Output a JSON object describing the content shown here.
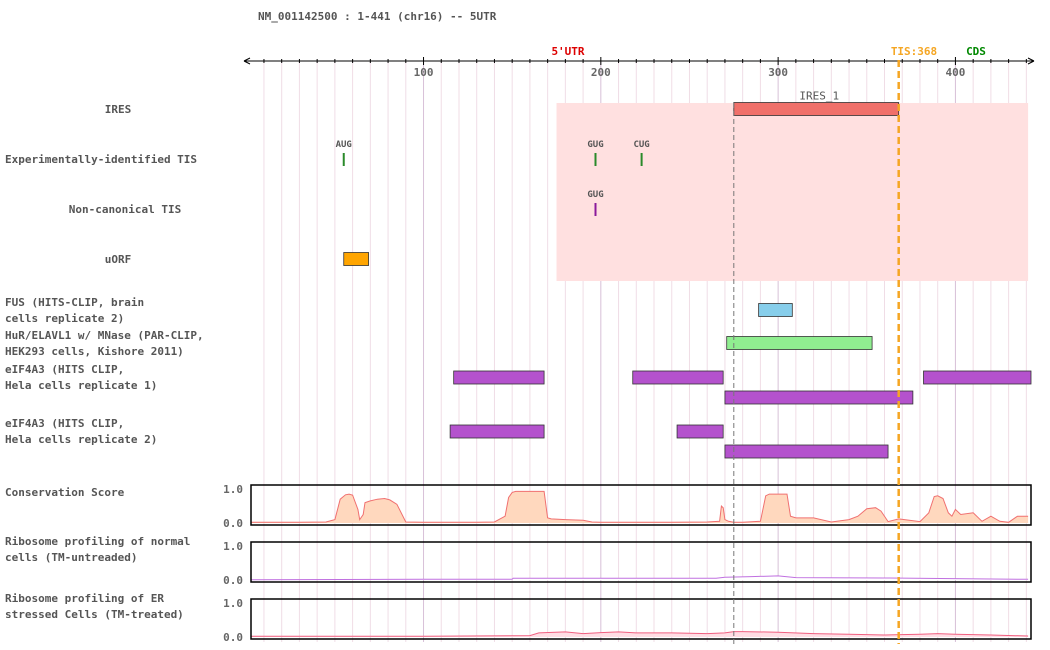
{
  "header": "NM_001142500 : 1-441 (chr16) -- 5UTR",
  "colors": {
    "utr_label": "#dd0000",
    "tis_line": "#f5a623",
    "cds_label": "#008800",
    "ires_bg": "#ffe0e0",
    "ires_bar": "#f0706a",
    "exp_tis": "#2a8a2a",
    "noncanonical": "#8b1a9b",
    "uorf": "#ffa500",
    "fus": "#87ceeb",
    "hur": "#90ee90",
    "eif4a3": "#b452cd",
    "conservation_fill": "#ffd8be",
    "conservation_line": "#f07070",
    "ribo_normal": "#c070e0",
    "ribo_stress": "#f06080"
  },
  "axis": {
    "min": 1,
    "max": 441,
    "ticks": [
      "100",
      "200",
      "300",
      "400"
    ],
    "utr_label": "5'UTR",
    "tis_label": "TIS:368",
    "cds_label": "CDS"
  },
  "chart_data": {
    "type": "genome_track",
    "transcript": "NM_001142500",
    "range": [
      1,
      441
    ],
    "tis_position": 368,
    "ires_highlight": [
      175,
      441
    ],
    "guide_line": 275,
    "tracks": [
      {
        "label_lines": [
          "IRES"
        ],
        "type": "features",
        "features": [
          {
            "start": 275,
            "end": 368,
            "name": "IRES_1",
            "color": "#f0706a"
          }
        ]
      },
      {
        "label_lines": [
          "Experimentally-identified TIS"
        ],
        "type": "sites",
        "sites": [
          {
            "pos": 55,
            "codon": "AUG",
            "color": "#2a8a2a"
          },
          {
            "pos": 197,
            "codon": "GUG",
            "color": "#2a8a2a"
          },
          {
            "pos": 223,
            "codon": "CUG",
            "color": "#2a8a2a"
          }
        ]
      },
      {
        "label_lines": [
          "Non-canonical TIS"
        ],
        "type": "sites",
        "sites": [
          {
            "pos": 197,
            "codon": "GUG",
            "color": "#8b1a9b"
          }
        ]
      },
      {
        "label_lines": [
          "uORF"
        ],
        "type": "features",
        "features": [
          {
            "start": 55,
            "end": 69,
            "color": "#ffa500"
          }
        ]
      },
      {
        "label_lines": [
          "FUS (HITS-CLIP, brain",
          "cells replicate 2)"
        ],
        "type": "features",
        "features": [
          {
            "start": 289,
            "end": 308,
            "color": "#87ceeb"
          }
        ]
      },
      {
        "label_lines": [
          "HuR/ELAVL1 w/ MNase (PAR-CLIP,",
          "HEK293 cells, Kishore 2011)"
        ],
        "type": "features",
        "features": [
          {
            "start": 271,
            "end": 353,
            "color": "#90ee90"
          }
        ]
      },
      {
        "label_lines": [
          "eIF4A3 (HITS CLIP,",
          "Hela cells replicate 1)"
        ],
        "type": "features",
        "features": [
          {
            "start": 117,
            "end": 168,
            "color": "#b452cd"
          },
          {
            "start": 218,
            "end": 269,
            "color": "#b452cd"
          },
          {
            "start": 382,
            "end": 443,
            "color": "#b452cd"
          },
          {
            "start": 270,
            "end": 376,
            "color": "#b452cd",
            "row": 1
          }
        ]
      },
      {
        "label_lines": [
          "eIF4A3 (HITS CLIP,",
          "Hela cells replicate 2)"
        ],
        "type": "features",
        "features": [
          {
            "start": 115,
            "end": 168,
            "color": "#b452cd"
          },
          {
            "start": 243,
            "end": 269,
            "color": "#b452cd"
          },
          {
            "start": 270,
            "end": 362,
            "color": "#b452cd",
            "row": 1
          }
        ]
      },
      {
        "label_lines": [
          "Conservation Score"
        ],
        "type": "signal",
        "ylim": [
          0,
          1
        ],
        "yticks": [
          "1.0",
          "0.0"
        ],
        "fill": "#ffd8be",
        "line": "#f07070",
        "x": [
          1,
          30,
          45,
          50,
          53,
          56,
          58,
          60,
          63,
          64,
          66,
          67,
          70,
          74,
          78,
          81,
          85,
          90,
          100,
          110,
          120,
          130,
          140,
          146,
          148,
          150,
          152,
          155,
          160,
          168,
          170,
          172,
          180,
          190,
          195,
          200,
          220,
          240,
          260,
          267,
          268,
          269,
          270,
          272,
          275,
          280,
          290,
          291,
          293,
          295,
          300,
          305,
          307,
          310,
          320,
          330,
          340,
          345,
          350,
          355,
          358,
          362,
          368,
          380,
          385,
          388,
          390,
          393,
          396,
          398,
          400,
          403,
          410,
          415,
          420,
          425,
          430,
          435,
          441
        ],
        "y": [
          0.02,
          0.02,
          0.03,
          0.1,
          0.7,
          0.83,
          0.85,
          0.82,
          0.4,
          0.1,
          0.25,
          0.6,
          0.65,
          0.7,
          0.72,
          0.68,
          0.55,
          0.03,
          0.02,
          0.02,
          0.02,
          0.02,
          0.03,
          0.2,
          0.75,
          0.9,
          0.93,
          0.93,
          0.93,
          0.93,
          0.15,
          0.12,
          0.1,
          0.08,
          0.03,
          0.02,
          0.02,
          0.02,
          0.03,
          0.05,
          0.5,
          0.45,
          0.1,
          0.05,
          0.02,
          0.02,
          0.05,
          0.3,
          0.8,
          0.85,
          0.85,
          0.85,
          0.2,
          0.15,
          0.15,
          0.03,
          0.1,
          0.2,
          0.42,
          0.45,
          0.35,
          0.04,
          0.12,
          0.04,
          0.3,
          0.78,
          0.8,
          0.72,
          0.3,
          0.2,
          0.4,
          0.25,
          0.3,
          0.05,
          0.2,
          0.05,
          0.02,
          0.2,
          0.2
        ]
      },
      {
        "label_lines": [
          "Ribosome profiling of normal",
          "cells (TM-untreaded)"
        ],
        "type": "signal",
        "ylim": [
          0,
          1
        ],
        "yticks": [
          "1.0",
          "0.0"
        ],
        "fill": "#ffffff",
        "line": "#c070e0",
        "x": [
          1,
          100,
          150,
          150.5,
          265,
          270,
          285,
          300,
          310,
          360,
          441
        ],
        "y": [
          0.01,
          0.02,
          0.02,
          0.05,
          0.05,
          0.08,
          0.1,
          0.12,
          0.07,
          0.06,
          0.02
        ]
      },
      {
        "label_lines": [
          "Ribosome profiling of ER",
          "stressed Cells (TM-treated)"
        ],
        "type": "signal",
        "ylim": [
          0,
          1
        ],
        "yticks": [
          "1.0",
          "0.0"
        ],
        "fill": "#ffdde4",
        "line": "#f06080",
        "x": [
          1,
          100,
          160,
          165,
          180,
          190,
          200,
          210,
          220,
          240,
          260,
          270,
          275,
          280,
          300,
          320,
          340,
          360,
          380,
          390,
          400,
          420,
          441
        ],
        "y": [
          0.02,
          0.02,
          0.04,
          0.12,
          0.15,
          0.1,
          0.13,
          0.15,
          0.12,
          0.12,
          0.1,
          0.12,
          0.16,
          0.16,
          0.14,
          0.1,
          0.08,
          0.06,
          0.08,
          0.1,
          0.08,
          0.06,
          0.03
        ]
      }
    ]
  }
}
